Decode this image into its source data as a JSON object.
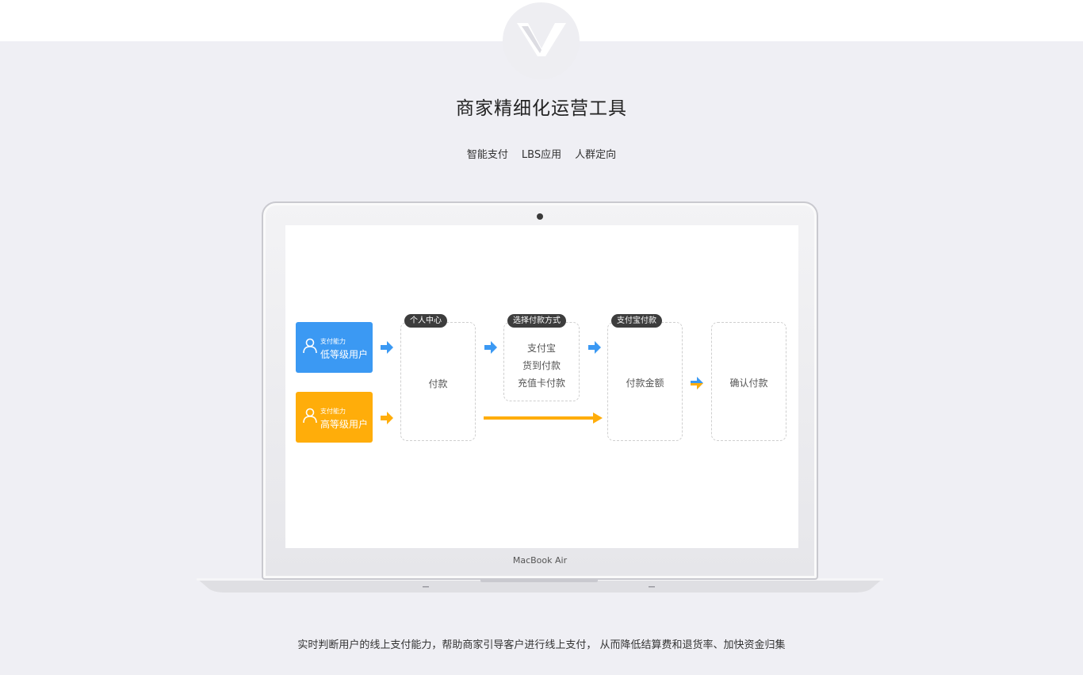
{
  "section": {
    "title": "商家精细化运营工具",
    "tabs": [
      "智能支付",
      "LBS应用",
      "人群定向"
    ],
    "description": "实时判断用户的线上支付能力，帮助商家引导客户进行线上支付， 从而降低结算费和退货率、加快资金归集"
  },
  "laptop": {
    "brand": "MacBook Air"
  },
  "flow": {
    "low_user": {
      "small": "支付能力",
      "big": "低等级用户",
      "color": "#3b99f3"
    },
    "high_user": {
      "small": "支付能力",
      "big": "高等级用户",
      "color": "#ffad0a"
    },
    "step1": {
      "tag": "个人中心",
      "label": "付款"
    },
    "step2": {
      "tag": "选择付款方式",
      "options": [
        "支付宝",
        "货到付款",
        "充值卡付款"
      ]
    },
    "step3": {
      "tag": "支付宝付款",
      "label": "付款金额"
    },
    "step4": {
      "label": "确认付款"
    }
  },
  "icons": [
    "logo-v-icon",
    "user-icon",
    "arrow-right-icon"
  ]
}
